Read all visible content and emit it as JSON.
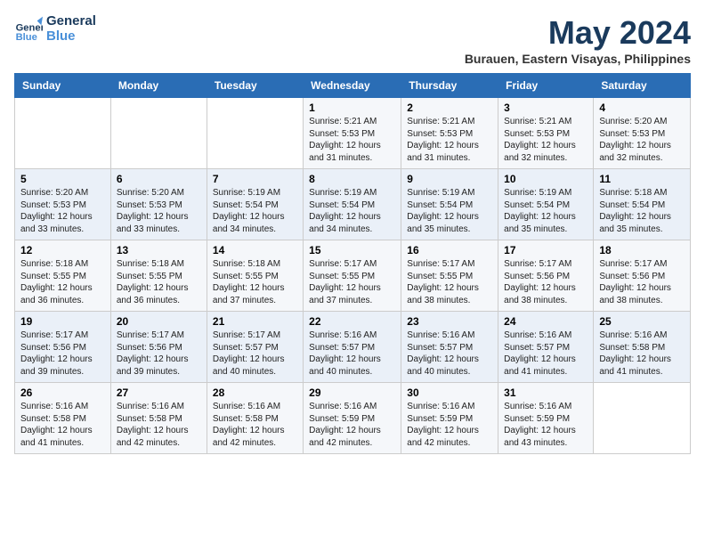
{
  "logo": {
    "line1": "General",
    "line2": "Blue"
  },
  "title": "May 2024",
  "subtitle": "Burauen, Eastern Visayas, Philippines",
  "days_of_week": [
    "Sunday",
    "Monday",
    "Tuesday",
    "Wednesday",
    "Thursday",
    "Friday",
    "Saturday"
  ],
  "weeks": [
    [
      {
        "num": "",
        "sunrise": "",
        "sunset": "",
        "daylight": ""
      },
      {
        "num": "",
        "sunrise": "",
        "sunset": "",
        "daylight": ""
      },
      {
        "num": "",
        "sunrise": "",
        "sunset": "",
        "daylight": ""
      },
      {
        "num": "1",
        "sunrise": "Sunrise: 5:21 AM",
        "sunset": "Sunset: 5:53 PM",
        "daylight": "Daylight: 12 hours and 31 minutes."
      },
      {
        "num": "2",
        "sunrise": "Sunrise: 5:21 AM",
        "sunset": "Sunset: 5:53 PM",
        "daylight": "Daylight: 12 hours and 31 minutes."
      },
      {
        "num": "3",
        "sunrise": "Sunrise: 5:21 AM",
        "sunset": "Sunset: 5:53 PM",
        "daylight": "Daylight: 12 hours and 32 minutes."
      },
      {
        "num": "4",
        "sunrise": "Sunrise: 5:20 AM",
        "sunset": "Sunset: 5:53 PM",
        "daylight": "Daylight: 12 hours and 32 minutes."
      }
    ],
    [
      {
        "num": "5",
        "sunrise": "Sunrise: 5:20 AM",
        "sunset": "Sunset: 5:53 PM",
        "daylight": "Daylight: 12 hours and 33 minutes."
      },
      {
        "num": "6",
        "sunrise": "Sunrise: 5:20 AM",
        "sunset": "Sunset: 5:53 PM",
        "daylight": "Daylight: 12 hours and 33 minutes."
      },
      {
        "num": "7",
        "sunrise": "Sunrise: 5:19 AM",
        "sunset": "Sunset: 5:54 PM",
        "daylight": "Daylight: 12 hours and 34 minutes."
      },
      {
        "num": "8",
        "sunrise": "Sunrise: 5:19 AM",
        "sunset": "Sunset: 5:54 PM",
        "daylight": "Daylight: 12 hours and 34 minutes."
      },
      {
        "num": "9",
        "sunrise": "Sunrise: 5:19 AM",
        "sunset": "Sunset: 5:54 PM",
        "daylight": "Daylight: 12 hours and 35 minutes."
      },
      {
        "num": "10",
        "sunrise": "Sunrise: 5:19 AM",
        "sunset": "Sunset: 5:54 PM",
        "daylight": "Daylight: 12 hours and 35 minutes."
      },
      {
        "num": "11",
        "sunrise": "Sunrise: 5:18 AM",
        "sunset": "Sunset: 5:54 PM",
        "daylight": "Daylight: 12 hours and 35 minutes."
      }
    ],
    [
      {
        "num": "12",
        "sunrise": "Sunrise: 5:18 AM",
        "sunset": "Sunset: 5:55 PM",
        "daylight": "Daylight: 12 hours and 36 minutes."
      },
      {
        "num": "13",
        "sunrise": "Sunrise: 5:18 AM",
        "sunset": "Sunset: 5:55 PM",
        "daylight": "Daylight: 12 hours and 36 minutes."
      },
      {
        "num": "14",
        "sunrise": "Sunrise: 5:18 AM",
        "sunset": "Sunset: 5:55 PM",
        "daylight": "Daylight: 12 hours and 37 minutes."
      },
      {
        "num": "15",
        "sunrise": "Sunrise: 5:17 AM",
        "sunset": "Sunset: 5:55 PM",
        "daylight": "Daylight: 12 hours and 37 minutes."
      },
      {
        "num": "16",
        "sunrise": "Sunrise: 5:17 AM",
        "sunset": "Sunset: 5:55 PM",
        "daylight": "Daylight: 12 hours and 38 minutes."
      },
      {
        "num": "17",
        "sunrise": "Sunrise: 5:17 AM",
        "sunset": "Sunset: 5:56 PM",
        "daylight": "Daylight: 12 hours and 38 minutes."
      },
      {
        "num": "18",
        "sunrise": "Sunrise: 5:17 AM",
        "sunset": "Sunset: 5:56 PM",
        "daylight": "Daylight: 12 hours and 38 minutes."
      }
    ],
    [
      {
        "num": "19",
        "sunrise": "Sunrise: 5:17 AM",
        "sunset": "Sunset: 5:56 PM",
        "daylight": "Daylight: 12 hours and 39 minutes."
      },
      {
        "num": "20",
        "sunrise": "Sunrise: 5:17 AM",
        "sunset": "Sunset: 5:56 PM",
        "daylight": "Daylight: 12 hours and 39 minutes."
      },
      {
        "num": "21",
        "sunrise": "Sunrise: 5:17 AM",
        "sunset": "Sunset: 5:57 PM",
        "daylight": "Daylight: 12 hours and 40 minutes."
      },
      {
        "num": "22",
        "sunrise": "Sunrise: 5:16 AM",
        "sunset": "Sunset: 5:57 PM",
        "daylight": "Daylight: 12 hours and 40 minutes."
      },
      {
        "num": "23",
        "sunrise": "Sunrise: 5:16 AM",
        "sunset": "Sunset: 5:57 PM",
        "daylight": "Daylight: 12 hours and 40 minutes."
      },
      {
        "num": "24",
        "sunrise": "Sunrise: 5:16 AM",
        "sunset": "Sunset: 5:57 PM",
        "daylight": "Daylight: 12 hours and 41 minutes."
      },
      {
        "num": "25",
        "sunrise": "Sunrise: 5:16 AM",
        "sunset": "Sunset: 5:58 PM",
        "daylight": "Daylight: 12 hours and 41 minutes."
      }
    ],
    [
      {
        "num": "26",
        "sunrise": "Sunrise: 5:16 AM",
        "sunset": "Sunset: 5:58 PM",
        "daylight": "Daylight: 12 hours and 41 minutes."
      },
      {
        "num": "27",
        "sunrise": "Sunrise: 5:16 AM",
        "sunset": "Sunset: 5:58 PM",
        "daylight": "Daylight: 12 hours and 42 minutes."
      },
      {
        "num": "28",
        "sunrise": "Sunrise: 5:16 AM",
        "sunset": "Sunset: 5:58 PM",
        "daylight": "Daylight: 12 hours and 42 minutes."
      },
      {
        "num": "29",
        "sunrise": "Sunrise: 5:16 AM",
        "sunset": "Sunset: 5:59 PM",
        "daylight": "Daylight: 12 hours and 42 minutes."
      },
      {
        "num": "30",
        "sunrise": "Sunrise: 5:16 AM",
        "sunset": "Sunset: 5:59 PM",
        "daylight": "Daylight: 12 hours and 42 minutes."
      },
      {
        "num": "31",
        "sunrise": "Sunrise: 5:16 AM",
        "sunset": "Sunset: 5:59 PM",
        "daylight": "Daylight: 12 hours and 43 minutes."
      },
      {
        "num": "",
        "sunrise": "",
        "sunset": "",
        "daylight": ""
      }
    ]
  ]
}
